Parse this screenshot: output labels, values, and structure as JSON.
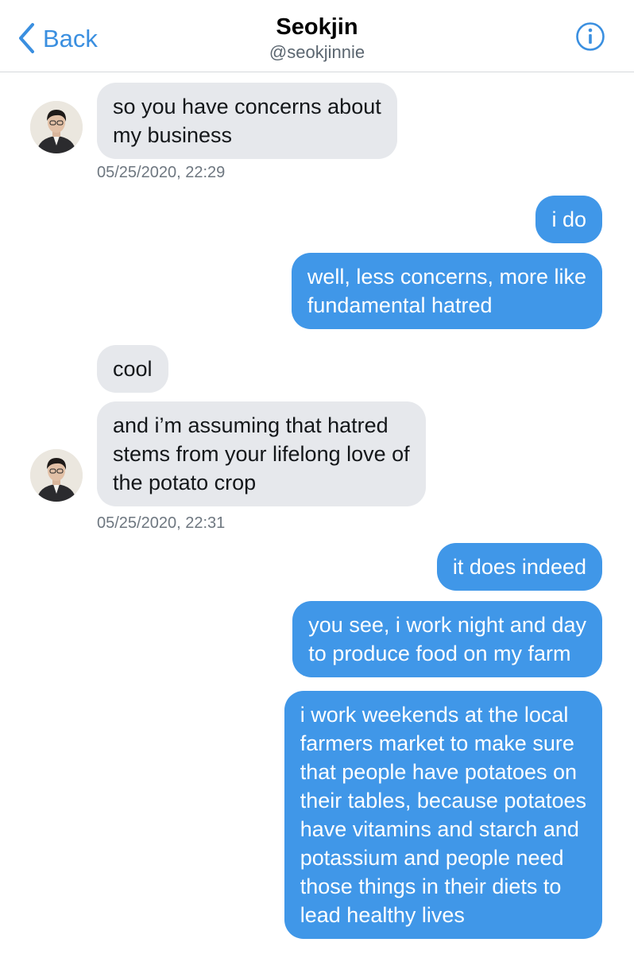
{
  "header": {
    "back_label": "Back",
    "title": "Seokjin",
    "handle": "@seokjinnie"
  },
  "accent_color": "#3a8fe0",
  "outgoing_bubble_color": "#4097e8",
  "incoming_bubble_color": "#e6e8ec",
  "icons": {
    "back": "chevron-left-icon",
    "info": "info-icon",
    "avatar": "avatar-photo"
  },
  "messages": [
    {
      "from": "them",
      "lines": [
        "so you have concerns about",
        "my business"
      ]
    },
    {
      "from": "me",
      "lines": [
        "i do"
      ]
    },
    {
      "from": "me",
      "lines": [
        "well, less concerns, more like",
        "fundamental hatred"
      ]
    },
    {
      "from": "them",
      "lines": [
        "cool"
      ]
    },
    {
      "from": "them",
      "lines": [
        "and i’m assuming that hatred",
        "stems from your lifelong love of",
        "the potato crop"
      ]
    },
    {
      "from": "me",
      "lines": [
        "it does indeed"
      ]
    },
    {
      "from": "me",
      "lines": [
        "you see, i work night and day",
        "to produce food on my farm"
      ]
    },
    {
      "from": "me",
      "lines": [
        "i work weekends at the local",
        "farmers market to make sure",
        "that people have potatoes on",
        "their tables, because potatoes",
        "have vitamins and starch and",
        "potassium and people need",
        "those things in their diets to",
        "lead healthy lives"
      ]
    }
  ],
  "timestamps": [
    "05/25/2020, 22:29",
    "05/25/2020, 22:31"
  ]
}
